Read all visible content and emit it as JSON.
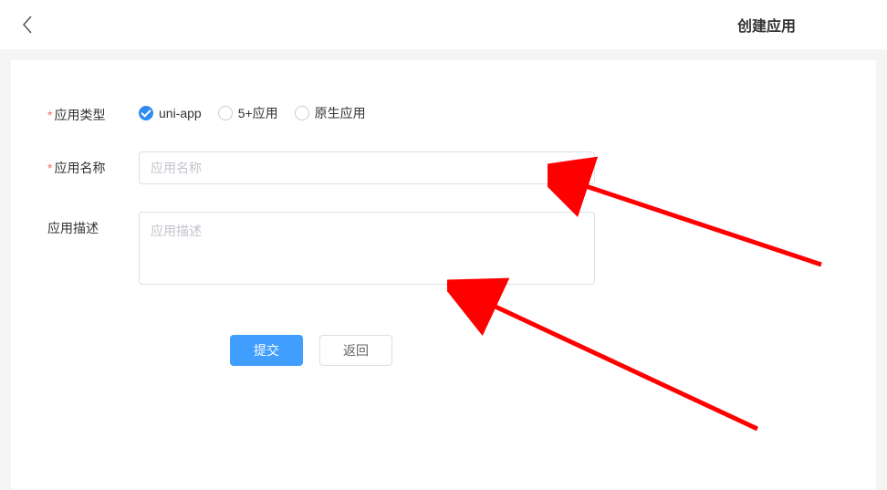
{
  "header": {
    "title": "创建应用"
  },
  "form": {
    "app_type": {
      "label": "应用类型",
      "required": true,
      "options": [
        {
          "label": "uni-app",
          "checked": true
        },
        {
          "label": "5+应用",
          "checked": false
        },
        {
          "label": "原生应用",
          "checked": false
        }
      ]
    },
    "app_name": {
      "label": "应用名称",
      "required": true,
      "placeholder": "应用名称",
      "value": ""
    },
    "app_desc": {
      "label": "应用描述",
      "required": false,
      "placeholder": "应用描述",
      "value": ""
    }
  },
  "buttons": {
    "submit": "提交",
    "back": "返回"
  }
}
